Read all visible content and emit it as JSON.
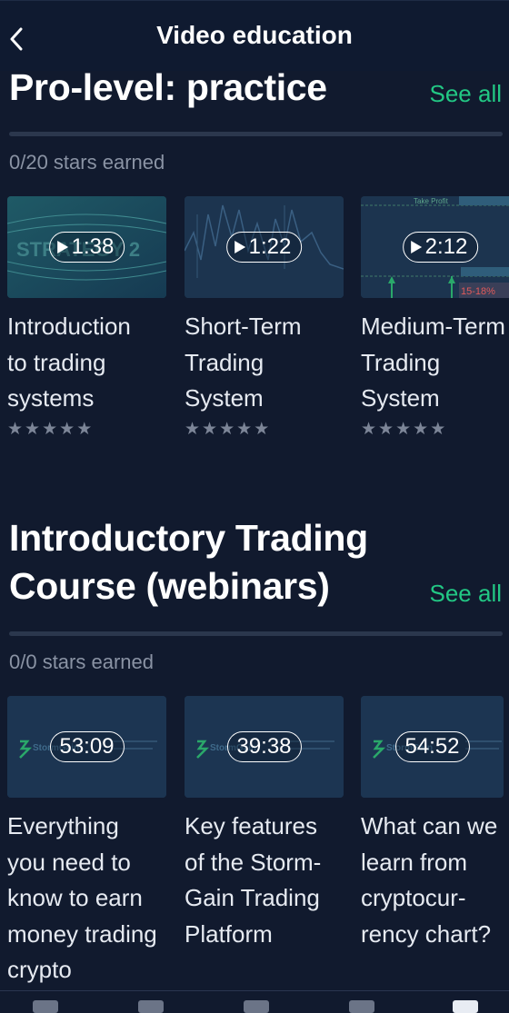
{
  "header": {
    "title": "Video education"
  },
  "sections": [
    {
      "title": "Pro-level: practice",
      "see_all": "See all",
      "stars_earned": "0/20 stars earned",
      "progress": 0,
      "cards": [
        {
          "duration": "1:38",
          "title": "Introduction\nto trading\nsystems",
          "rating": 0,
          "thumb": "strategy"
        },
        {
          "duration": "1:22",
          "title": "Short-Term\nTrading\nSystem",
          "rating": 0,
          "thumb": "chart"
        },
        {
          "duration": "2:12",
          "title": "Medium-Term\nTrading\nSystem",
          "rating": 0,
          "thumb": "takeprofit"
        }
      ]
    },
    {
      "title": "Introductory Trading\nCourse (webinars)",
      "see_all": "See all",
      "stars_earned": "0/0 stars earned",
      "progress": 0,
      "cards": [
        {
          "duration": "53:09",
          "title": "Everything\nyou need to\nknow to earn\nmoney trading\ncrypto",
          "rating": null,
          "thumb": "stormgain"
        },
        {
          "duration": "39:38",
          "title": "Key features\nof the Storm-\nGain Trading\nPlatform",
          "rating": null,
          "thumb": "stormgain"
        },
        {
          "duration": "54:52",
          "title": "What can we\nlearn from\ncryptocur-\nrency chart?",
          "rating": null,
          "thumb": "stormgain"
        }
      ]
    }
  ],
  "thumb_text": {
    "strategy": "STRATEGY 2",
    "takeprofit_label": "Take Profit",
    "takeprofit_pct": "15-18%",
    "stormgain": "StormGain"
  },
  "colors": {
    "accent": "#22c784",
    "background": "#111a2e",
    "header": "#0f1a30"
  },
  "icons": {
    "back": "chevron-left-icon",
    "play": "play-icon",
    "star": "star-icon"
  }
}
